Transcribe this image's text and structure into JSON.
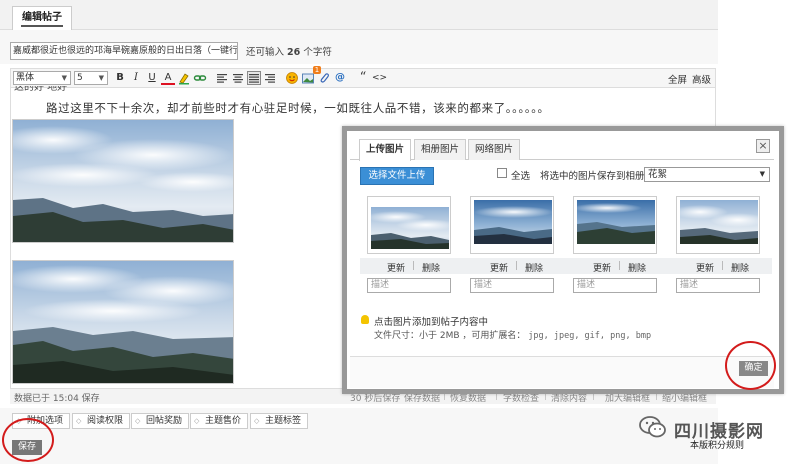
{
  "tabs": {
    "active": "编辑帖子"
  },
  "title": {
    "value": "嘉威都很近也很远的邛海旱碗嘉原般的日出日落（一键行",
    "count_prefix": "还可输入",
    "count_value": "26",
    "count_suffix": "个字符"
  },
  "toolbar": {
    "font_family": "黑体",
    "font_size": "5",
    "bold": "B",
    "italic": "I",
    "underline": "U",
    "font_color": "A",
    "badge_count": "1",
    "at": "@",
    "quote": "“",
    "code": "<>",
    "fullscreen": "全屏",
    "advanced": "高级"
  },
  "editor": {
    "body_text": "路过这里不下十余次，却才前些时才有心驻足时候，一如既往人品不错，该来的都来了。。。。。。",
    "partial_top_line": "这的好 地好"
  },
  "status": {
    "saved": "数据已于 15:04 保存",
    "autosave": "30 秒后保存",
    "links": [
      "保存数据",
      "恢复数据",
      "字数检查",
      "清除内容",
      "加大编辑框",
      "缩小编辑框"
    ]
  },
  "options": [
    "附加选项",
    "阅读权限",
    "回帖奖励",
    "主题售价",
    "主题标签"
  ],
  "save_button": "保存",
  "modal": {
    "tabs": [
      "上传图片",
      "相册图片",
      "网络图片"
    ],
    "close": "×",
    "upload_button": "选择文件上传",
    "select_all": "全选",
    "save_to_album_label": "将选中的图片保存到相册:",
    "album_value": "花絮",
    "thumbs": [
      {
        "update": "更新",
        "delete": "删除",
        "desc_placeholder": "描述"
      },
      {
        "update": "更新",
        "delete": "删除",
        "desc_placeholder": "描述"
      },
      {
        "update": "更新",
        "delete": "删除",
        "desc_placeholder": "描述"
      },
      {
        "update": "更新",
        "delete": "删除",
        "desc_placeholder": "描述"
      }
    ],
    "tip": "点击图片添加到帖子内容中",
    "file_size": "文件尺寸：小于 2MB ，可用扩展名：",
    "extensions": "jpg, jpeg, gif, png, bmp",
    "confirm": "确定"
  },
  "watermark": {
    "text": "四川摄影网",
    "sub": "本版积分规则"
  },
  "colors": {
    "accent_blue": "#3b8fd6",
    "annotation_red": "#d31b1b",
    "badge_orange": "#f07d1a"
  }
}
